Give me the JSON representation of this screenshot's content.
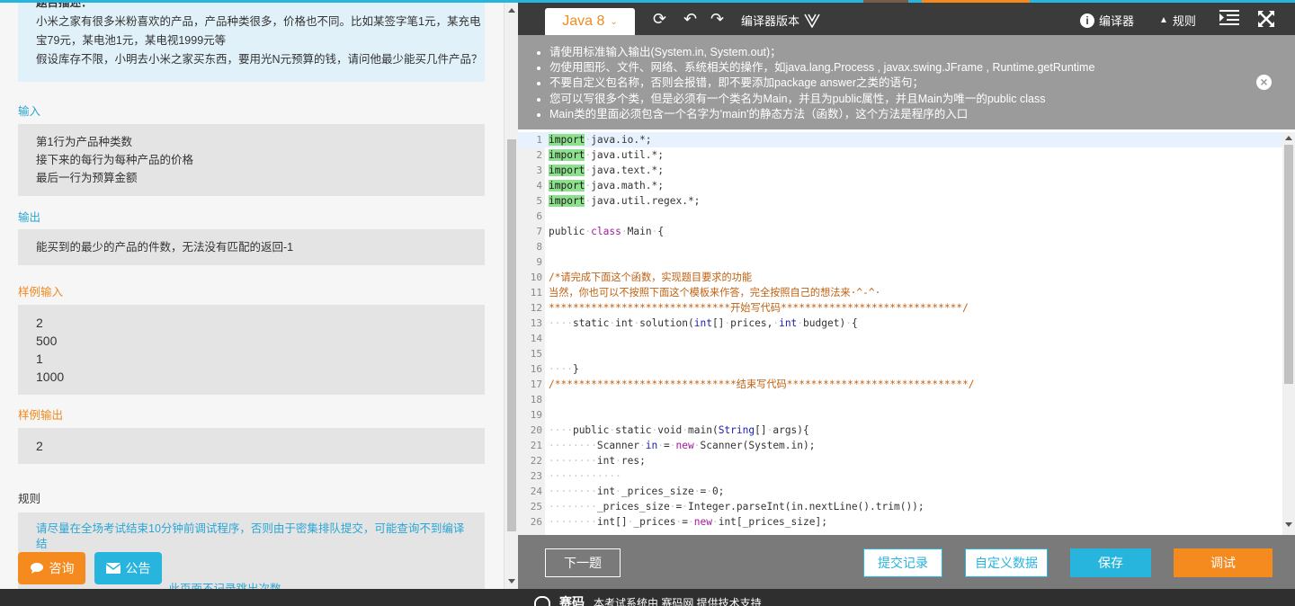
{
  "problem": {
    "desc_heading": "题目描述：",
    "desc_lines": [
      "小米之家有很多米粉喜欢的产品，产品种类很多，价格也不同。比如某签字笔1元，某充电",
      "宝79元，某电池1元，某电视1999元等",
      "假设库存不限，小明去小米之家买东西，要用光N元预算的钱，请问他最少能买几件产品？"
    ],
    "input_label": "输入",
    "input_lines": [
      "第1行为产品种类数",
      "接下来的每行为每种产品的价格",
      "最后一行为预算金额"
    ],
    "output_label": "输出",
    "output_text": "能买到的最少的产品的件数，无法没有匹配的返回-1",
    "sample_input_label": "样例输入",
    "sample_input_lines": [
      "2",
      "500",
      "1",
      "1000"
    ],
    "sample_output_label": "样例输出",
    "sample_output": "2",
    "rules_label": "规则",
    "rules_lines": [
      "请尽量在全场考试结束10分钟前调试程序，否则由于密集排队提交，可能查询不到编译结",
      "果",
      "，此页面不记录跳出次数"
    ]
  },
  "float_buttons": {
    "consult": "咨询",
    "notice": "公告"
  },
  "toolbar": {
    "language": "Java 8",
    "compiler_version": "编译器版本",
    "compiler": "编译器",
    "rules": "规则"
  },
  "notices": [
    "请使用标准输入输出(System.in, System.out)；",
    "勿使用图形、文件、网络、系统相关的操作，如java.lang.Process , javax.swing.JFrame , Runtime.getRuntime",
    "不要自定义包名称，否则会报错，即不要添加package answer之类的语句；",
    "您可以写很多个类，但是必须有一个类名为Main，并且为public属性，并且Main为唯一的public class",
    "Main类的里面必须包含一个名字为'main'的静态方法（函数），这个方法是程序的入口"
  ],
  "code_lines": [
    {
      "n": "1",
      "parts": [
        [
          "kw-imp",
          "import"
        ],
        [
          "ws",
          "·"
        ],
        [
          "",
          "java.io.*;"
        ]
      ]
    },
    {
      "n": "2",
      "parts": [
        [
          "kw-imp",
          "import"
        ],
        [
          "ws",
          "·"
        ],
        [
          "",
          "java.util.*;"
        ]
      ]
    },
    {
      "n": "3",
      "parts": [
        [
          "kw-imp",
          "import"
        ],
        [
          "ws",
          "·"
        ],
        [
          "",
          "java.text.*;"
        ]
      ]
    },
    {
      "n": "4",
      "parts": [
        [
          "kw-imp",
          "import"
        ],
        [
          "ws",
          "·"
        ],
        [
          "",
          "java.math.*;"
        ]
      ]
    },
    {
      "n": "5",
      "parts": [
        [
          "kw-imp",
          "import"
        ],
        [
          "ws",
          "·"
        ],
        [
          "",
          "java.util.regex.*;"
        ]
      ]
    },
    {
      "n": "6",
      "parts": []
    },
    {
      "n": "7",
      "parts": [
        [
          "",
          "public"
        ],
        [
          "ws",
          "·"
        ],
        [
          "kw2",
          "class"
        ],
        [
          "ws",
          "·"
        ],
        [
          "",
          "Main"
        ],
        [
          "ws",
          "·"
        ],
        [
          "",
          "{"
        ]
      ]
    },
    {
      "n": "8",
      "parts": []
    },
    {
      "n": "9",
      "parts": []
    },
    {
      "n": "10",
      "parts": [
        [
          "cm",
          "/*请完成下面这个函数，实现题目要求的功能"
        ]
      ]
    },
    {
      "n": "11",
      "parts": [
        [
          "cm",
          "当然，你也可以不按照下面这个模板来作答，完全按照自己的想法来·^-^·"
        ]
      ]
    },
    {
      "n": "12",
      "parts": [
        [
          "cm",
          "******************************开始写代码******************************/"
        ]
      ]
    },
    {
      "n": "13",
      "parts": [
        [
          "ws",
          "····"
        ],
        [
          "",
          "static"
        ],
        [
          "ws",
          "·"
        ],
        [
          "",
          "int"
        ],
        [
          "ws",
          "·"
        ],
        [
          "",
          "solution("
        ],
        [
          "kw",
          "int"
        ],
        [
          "",
          "[]"
        ],
        [
          "ws",
          "·"
        ],
        [
          "",
          "prices,"
        ],
        [
          "ws",
          "·"
        ],
        [
          "kw",
          "int"
        ],
        [
          "ws",
          "·"
        ],
        [
          "",
          "budget)"
        ],
        [
          "ws",
          "·"
        ],
        [
          "",
          "{"
        ]
      ]
    },
    {
      "n": "14",
      "parts": []
    },
    {
      "n": "15",
      "parts": []
    },
    {
      "n": "16",
      "parts": [
        [
          "ws",
          "····"
        ],
        [
          "",
          "}"
        ]
      ]
    },
    {
      "n": "17",
      "parts": [
        [
          "cm",
          "/******************************结束写代码******************************/"
        ]
      ]
    },
    {
      "n": "18",
      "parts": []
    },
    {
      "n": "19",
      "parts": []
    },
    {
      "n": "20",
      "parts": [
        [
          "ws",
          "····"
        ],
        [
          "",
          "public"
        ],
        [
          "ws",
          "·"
        ],
        [
          "",
          "static"
        ],
        [
          "ws",
          "·"
        ],
        [
          "",
          "void"
        ],
        [
          "ws",
          "·"
        ],
        [
          "",
          "main("
        ],
        [
          "kw",
          "String"
        ],
        [
          "",
          "[]"
        ],
        [
          "ws",
          "·"
        ],
        [
          "",
          "args){"
        ]
      ]
    },
    {
      "n": "21",
      "parts": [
        [
          "ws",
          "········"
        ],
        [
          "",
          "Scanner"
        ],
        [
          "ws",
          "·"
        ],
        [
          "kw",
          "in"
        ],
        [
          "ws",
          "·"
        ],
        [
          "",
          "="
        ],
        [
          "ws",
          "·"
        ],
        [
          "kw2",
          "new"
        ],
        [
          "ws",
          "·"
        ],
        [
          "",
          "Scanner(System.in);"
        ]
      ]
    },
    {
      "n": "22",
      "parts": [
        [
          "ws",
          "········"
        ],
        [
          "",
          "int"
        ],
        [
          "ws",
          "·"
        ],
        [
          "",
          "res;"
        ]
      ]
    },
    {
      "n": "23",
      "parts": [
        [
          "ws",
          "············"
        ]
      ]
    },
    {
      "n": "24",
      "parts": [
        [
          "ws",
          "········"
        ],
        [
          "",
          "int"
        ],
        [
          "ws",
          "·"
        ],
        [
          "",
          "_prices_size"
        ],
        [
          "ws",
          "·"
        ],
        [
          "",
          "="
        ],
        [
          "ws",
          "·"
        ],
        [
          "",
          "0;"
        ]
      ]
    },
    {
      "n": "25",
      "parts": [
        [
          "ws",
          "········"
        ],
        [
          "",
          "_prices_size"
        ],
        [
          "ws",
          "·"
        ],
        [
          "",
          "="
        ],
        [
          "ws",
          "·"
        ],
        [
          "",
          "Integer.parseInt(in.nextLine().trim());"
        ]
      ]
    },
    {
      "n": "26",
      "parts": [
        [
          "ws",
          "········"
        ],
        [
          "",
          "int[]"
        ],
        [
          "ws",
          "·"
        ],
        [
          "",
          "_prices"
        ],
        [
          "ws",
          "·"
        ],
        [
          "",
          "="
        ],
        [
          "ws",
          "·"
        ],
        [
          "kw2",
          "new"
        ],
        [
          "ws",
          "·"
        ],
        [
          "",
          "int[_prices_size];"
        ]
      ]
    }
  ],
  "bottom": {
    "next": "下一题",
    "records": "提交记录",
    "custom": "自定义数据",
    "save": "保存",
    "debug": "调试"
  },
  "footer": {
    "brand": "赛码",
    "text": "本考试系统由 赛码网 提供技术支持"
  }
}
